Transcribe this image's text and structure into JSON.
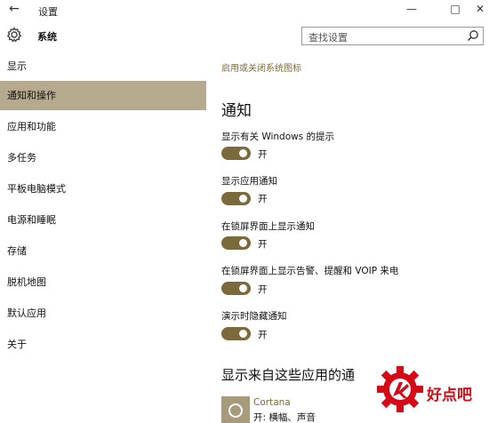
{
  "window": {
    "back_glyph": "←",
    "title": "设置",
    "minimize_glyph": "—",
    "maximize_glyph": "□",
    "close_glyph": "✕"
  },
  "header": {
    "section_title": "系统",
    "search_placeholder": "查找设置"
  },
  "sidebar": {
    "items": [
      {
        "label": "显示"
      },
      {
        "label": "通知和操作",
        "active": true
      },
      {
        "label": "应用和功能"
      },
      {
        "label": "多任务"
      },
      {
        "label": "平板电脑模式"
      },
      {
        "label": "电源和睡眠"
      },
      {
        "label": "存储"
      },
      {
        "label": "脱机地图"
      },
      {
        "label": "默认应用"
      },
      {
        "label": "关于"
      }
    ]
  },
  "main": {
    "top_link": "启用或关闭系统图标",
    "heading": "通知",
    "settings": [
      {
        "label": "显示有关 Windows 的提示",
        "state": "开",
        "on": true
      },
      {
        "label": "显示应用通知",
        "state": "开",
        "on": true
      },
      {
        "label": "在锁屏界面上显示通知",
        "state": "开",
        "on": true
      },
      {
        "label": "在锁屏界面上显示告警、提醒和 VOIP 来电",
        "state": "开",
        "on": true
      },
      {
        "label": "演示时隐藏通知",
        "state": "开",
        "on": true
      }
    ],
    "apps_heading": "显示来自这些应用的通",
    "apps": [
      {
        "name": "Cortana",
        "status": "开: 横幅、声音",
        "icon": "cortana-ring-icon"
      }
    ]
  },
  "watermark": {
    "text": "好点吧"
  },
  "colors": {
    "accent": "#7a6a3c",
    "nav_active": "#b5a98e",
    "link": "#7c6b3a",
    "watermark_red": "#d40b16"
  }
}
